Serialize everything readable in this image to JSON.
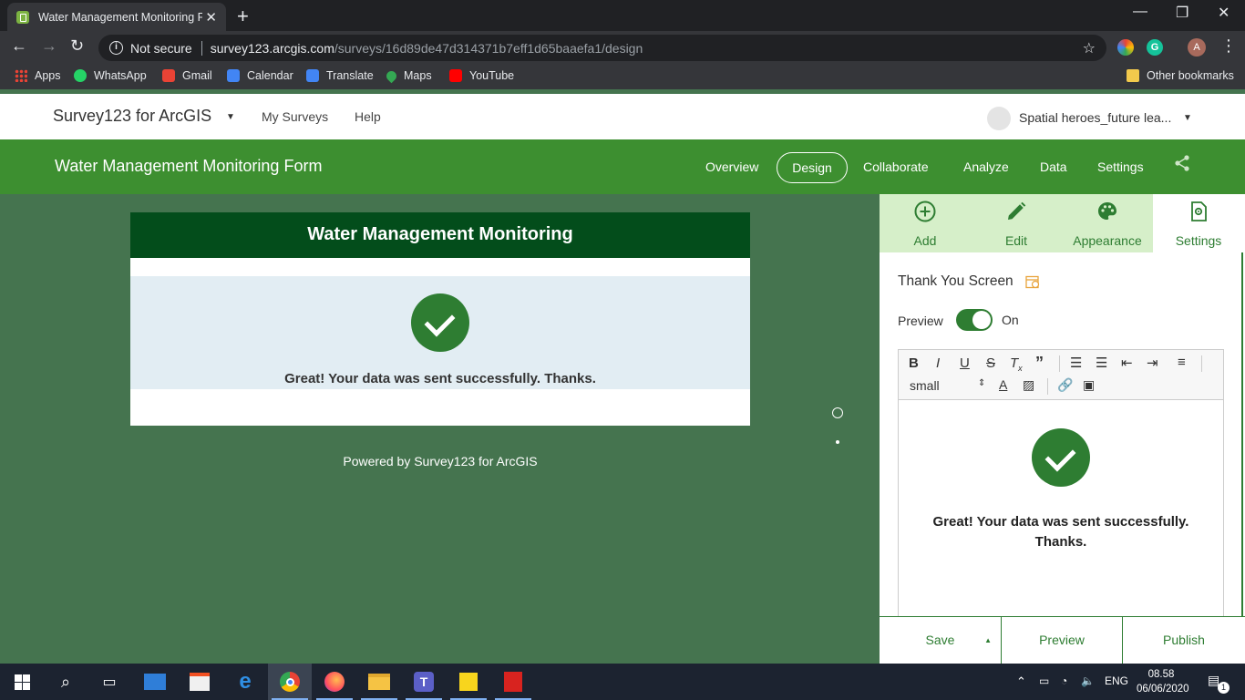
{
  "browser": {
    "tab_title": "Water Management Monitoring F",
    "url": {
      "not_secure": "Not secure",
      "host": "survey123.arcgis.com",
      "path": "/surveys/16d89de47d314371b7eff1d65baaefa1/design"
    },
    "profile_initial": "A",
    "bookmarks": [
      {
        "label": "Apps",
        "icon": "apps-grid-icon"
      },
      {
        "label": "WhatsApp",
        "icon": "whatsapp-icon",
        "color": "#25d366"
      },
      {
        "label": "Gmail",
        "icon": "gmail-icon",
        "color": "#ea4335"
      },
      {
        "label": "Calendar",
        "icon": "calendar-icon",
        "color": "#4285f4"
      },
      {
        "label": "Translate",
        "icon": "translate-icon",
        "color": "#4285f4"
      },
      {
        "label": "Maps",
        "icon": "maps-icon",
        "color": "#34a853"
      },
      {
        "label": "YouTube",
        "icon": "youtube-icon",
        "color": "#ff0000"
      }
    ],
    "other_bookmarks": "Other bookmarks"
  },
  "app": {
    "brand": "Survey123 for ArcGIS",
    "nav": {
      "my_surveys": "My Surveys",
      "help": "Help"
    },
    "user_name": "Spatial heroes_future lea..."
  },
  "form": {
    "title": "Water Management Monitoring Form",
    "tabs": {
      "overview": "Overview",
      "design": "Design",
      "collaborate": "Collaborate",
      "analyze": "Analyze",
      "data": "Data",
      "settings": "Settings"
    }
  },
  "preview_card": {
    "header": "Water Management Monitoring",
    "message": "Great! Your data was sent successfully. Thanks.",
    "powered_by": "Powered by Survey123 for ArcGIS"
  },
  "panel": {
    "tabs": {
      "add": "Add",
      "edit": "Edit",
      "appearance": "Appearance",
      "settings": "Settings"
    },
    "section_title": "Thank You Screen",
    "preview_label": "Preview",
    "preview_state": "On",
    "font_size": "small",
    "editor_message": "Great! Your data was sent successfully. Thanks.",
    "footer": {
      "save": "Save",
      "preview": "Preview",
      "publish": "Publish"
    }
  },
  "taskbar": {
    "language": "ENG",
    "time": "08.58",
    "date": "06/06/2020",
    "notifications": "1"
  },
  "colors": {
    "brand_green": "#3d8f30",
    "dark_green": "#034d1b",
    "canvas_green": "#45744f",
    "success": "#2e7d32"
  }
}
